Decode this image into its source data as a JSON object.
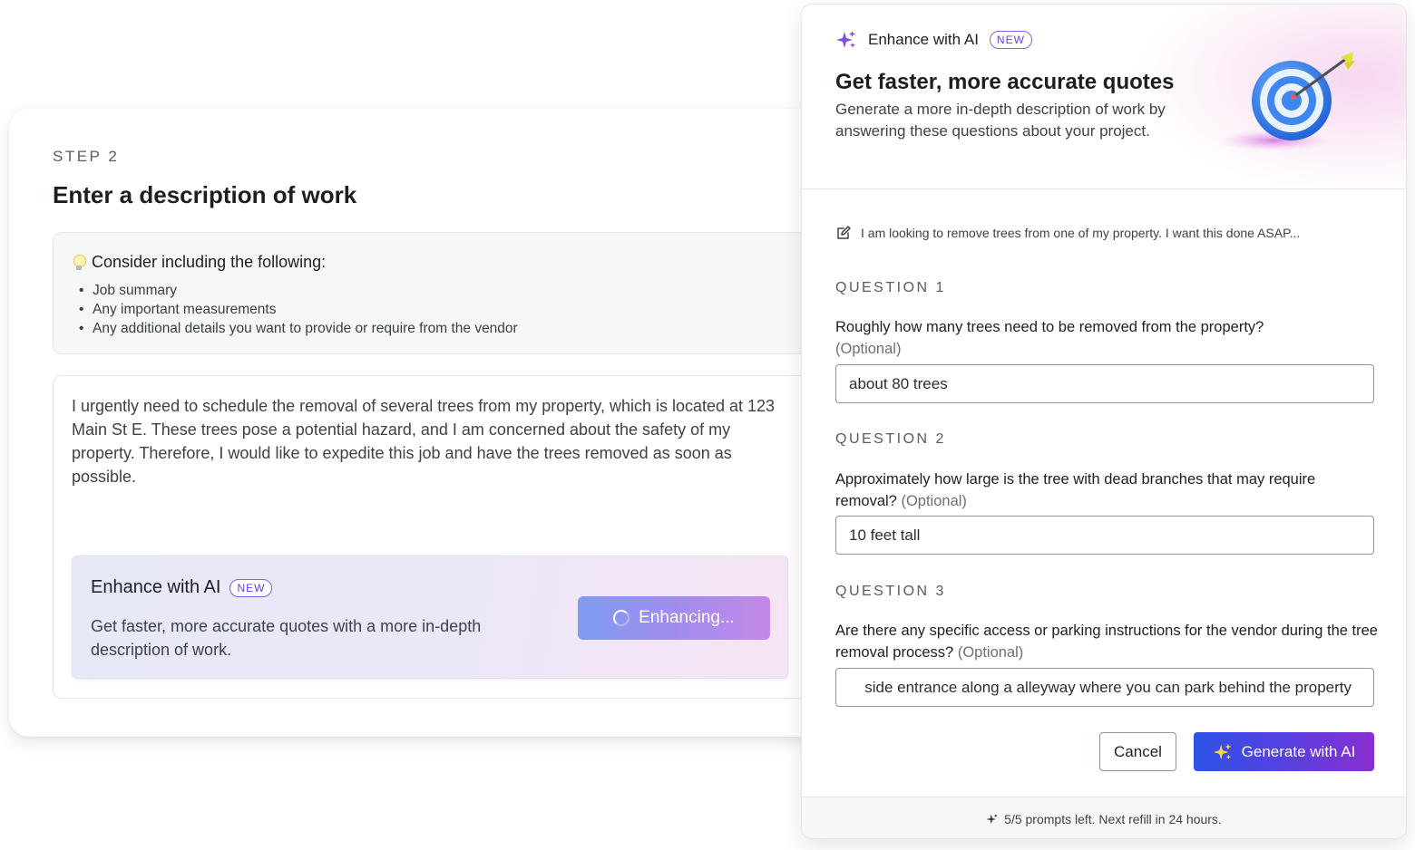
{
  "step": {
    "label": "STEP 2",
    "title": "Enter a description of work"
  },
  "tips": {
    "heading": "Consider including the following:",
    "items": [
      "Job summary",
      "Any important measurements",
      "Any additional details you want to provide or require from the vendor"
    ]
  },
  "description": {
    "text": "I urgently need to schedule the removal of several trees from my property, which is located at 123 Main St E. These trees pose a potential hazard, and I am concerned about the safety of my property. Therefore, I would like to expedite this job and have the trees removed as soon as possible."
  },
  "enhance_card": {
    "title": "Enhance with AI",
    "badge": "NEW",
    "subtitle": "Get faster, more accurate quotes with a more in-depth description of work.",
    "button_label": "Enhancing..."
  },
  "panel": {
    "brand": "Enhance with AI",
    "badge": "NEW",
    "title": "Get faster, more accurate quotes",
    "subtitle": "Generate a more in-depth description of work by answering these questions about your project.",
    "prompt_preview": "I am looking to remove trees from one of my property. I want this done ASAP...",
    "optional_label": "(Optional)",
    "questions": [
      {
        "label": "QUESTION 1",
        "text": "Roughly how many trees need to be removed from the property?",
        "answer": "about 80 trees"
      },
      {
        "label": "QUESTION 2",
        "text": "Approximately how large is the tree with dead branches that may require removal?",
        "answer": "10 feet tall"
      },
      {
        "label": "QUESTION 3",
        "text": "Are there any specific access or parking instructions for the vendor during the tree removal process?",
        "answer": "side entrance along a alleyway where you can park behind the property"
      }
    ],
    "cancel_label": "Cancel",
    "generate_label": "Generate with AI",
    "footer_text": "5/5 prompts left. Next refill in 24 hours."
  },
  "colors": {
    "accent_purple": "#6b3ee0",
    "generate_gradient_start": "#2b53e6",
    "generate_gradient_end": "#8a2ed0",
    "enhancing_gradient_start": "#7f9cf0",
    "enhancing_gradient_end": "#c388e8"
  }
}
